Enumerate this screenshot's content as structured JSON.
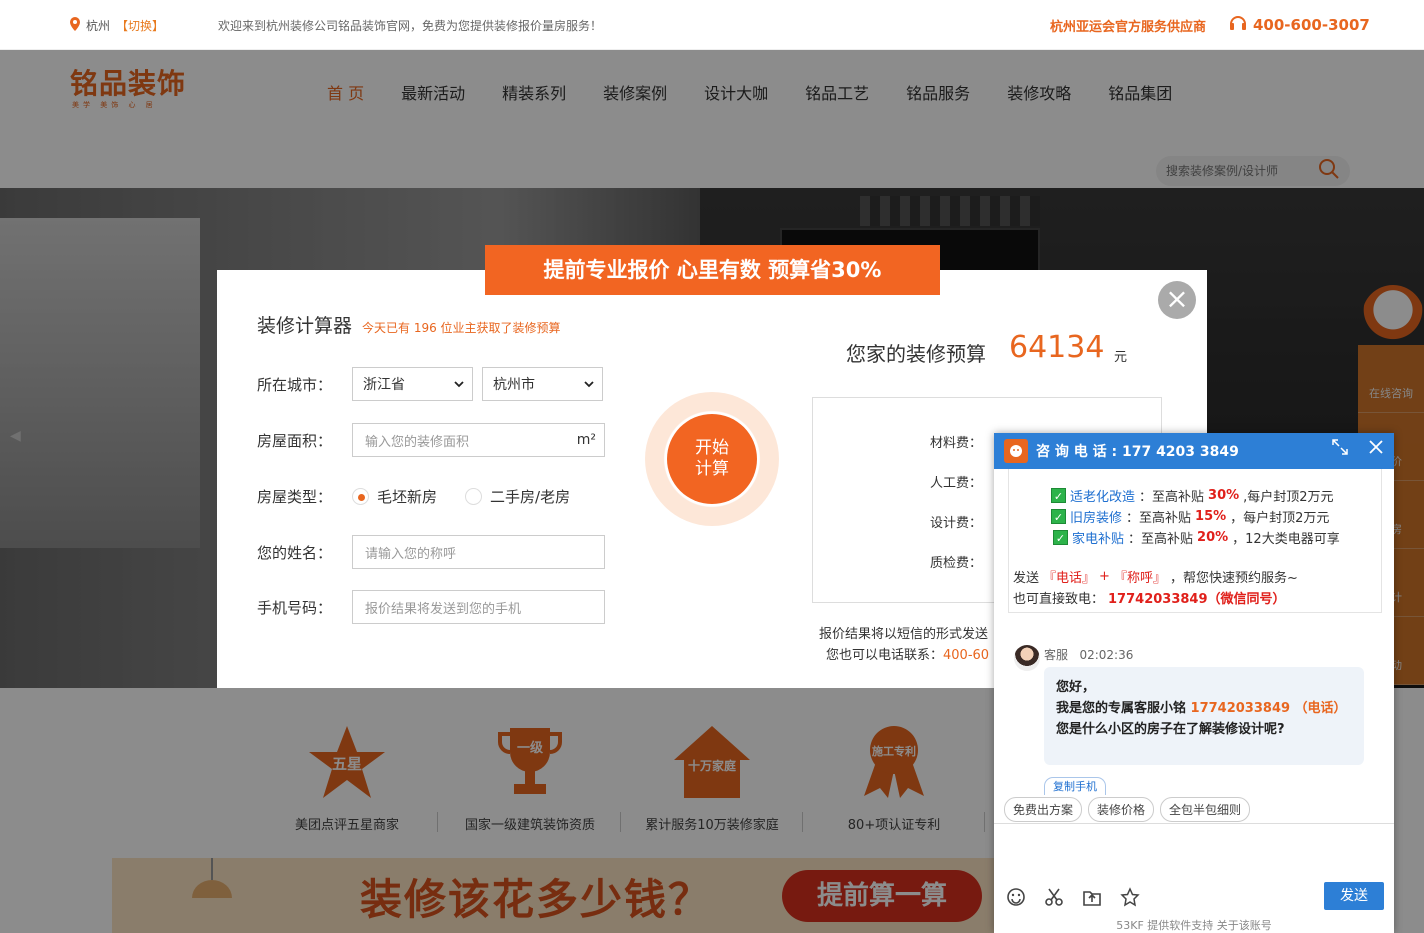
{
  "topbar": {
    "city": "杭州",
    "switch": "【切换】",
    "welcome": "欢迎来到杭州装修公司铭品装饰官网，免费为您提供装修报价量房服务！",
    "partner": "杭州亚运会官方服务供应商",
    "hotline": "400-600-3007"
  },
  "header": {
    "logo_main": "铭品装饰",
    "logo_sub": "美学 美饰 心 居",
    "nav": [
      "首 页",
      "最新活动",
      "精装系列",
      "装修案例",
      "设计大咖",
      "铭品工艺",
      "铭品服务",
      "装修攻略",
      "铭品集团"
    ],
    "search_placeholder": "搜索装修案例/设计师"
  },
  "sidetools": [
    "在线咨询",
    "报价",
    "量房",
    "设计",
    "活动"
  ],
  "modal": {
    "banner": "提前专业报价 心里有数 预算省30%",
    "title": "装修计算器",
    "note": "今天已有 196 位业主获取了装修预算",
    "city_label": "所在城市：",
    "province": "浙江省",
    "city": "杭州市",
    "area_label": "房屋面积：",
    "area_placeholder": "输入您的装修面积",
    "area_unit": "m²",
    "type_label": "房屋类型：",
    "type_opt1": "毛坯新房",
    "type_opt2": "二手房/老房",
    "name_label": "您的姓名：",
    "name_placeholder": "请输入您的称呼",
    "phone_label": "手机号码：",
    "phone_placeholder": "报价结果将发送到您的手机",
    "start_line1": "开始",
    "start_line2": "计算",
    "budget_label": "您家的装修预算",
    "budget_value": "64134",
    "budget_unit": "元",
    "costs": [
      "材料费：",
      "人工费：",
      "设计费：",
      "质检费："
    ],
    "result_note1": "报价结果将以短信的形式发送",
    "result_note2": "您也可以电话联系：",
    "result_phone": "400-60"
  },
  "badges": [
    {
      "icon_text": "五星",
      "label": "美团点评五星商家"
    },
    {
      "icon_text": "一级",
      "label": "国家一级建筑装饰资质"
    },
    {
      "icon_text": "十万家庭",
      "label": "累计服务10万装修家庭"
    },
    {
      "icon_text": "施工专利",
      "label": "80+项认证专利"
    }
  ],
  "banner": {
    "question": "装修该花多少钱？",
    "button": "提前算一算"
  },
  "chat": {
    "header": "咨 询 电 话 : 177 4203 3849",
    "promo": [
      {
        "name": "适老化改造",
        "text": "：至高补贴",
        "pct": "30%",
        "rest": ",每户封顶2万元"
      },
      {
        "name": "旧房装修",
        "text": "：至高补贴",
        "pct": "15%",
        "rest": "，每户封顶2万元"
      },
      {
        "name": "家电补贴",
        "text": "：至高补贴",
        "pct": "20%",
        "rest": "，12大类电器可享"
      }
    ],
    "send_line_pre": "发送",
    "send_tag1": "『电话』",
    "send_plus": "+",
    "send_tag2": "『称呼』",
    "send_line_post": "，帮您快速预约服务~",
    "direct_pre": "也可直接致电：",
    "direct_phone": "17742033849（微信同号）",
    "agent_name": "客服",
    "agent_time": "02:02:36",
    "msg1": "您好，",
    "msg2_pre": "我是您的专属客服小铭 ",
    "msg2_phone": "17742033849  （电话）",
    "msg3": "您是什么小区的房子在了解装修设计呢?",
    "copy_btn": "复制手机",
    "quick": [
      "免费出方案",
      "装修价格",
      "全包半包细则"
    ],
    "send": "发送",
    "powered": "53KF 提供软件支持  关于该账号"
  },
  "colors": {
    "accent": "#e8661f",
    "chat_blue": "#2d7fd6"
  }
}
